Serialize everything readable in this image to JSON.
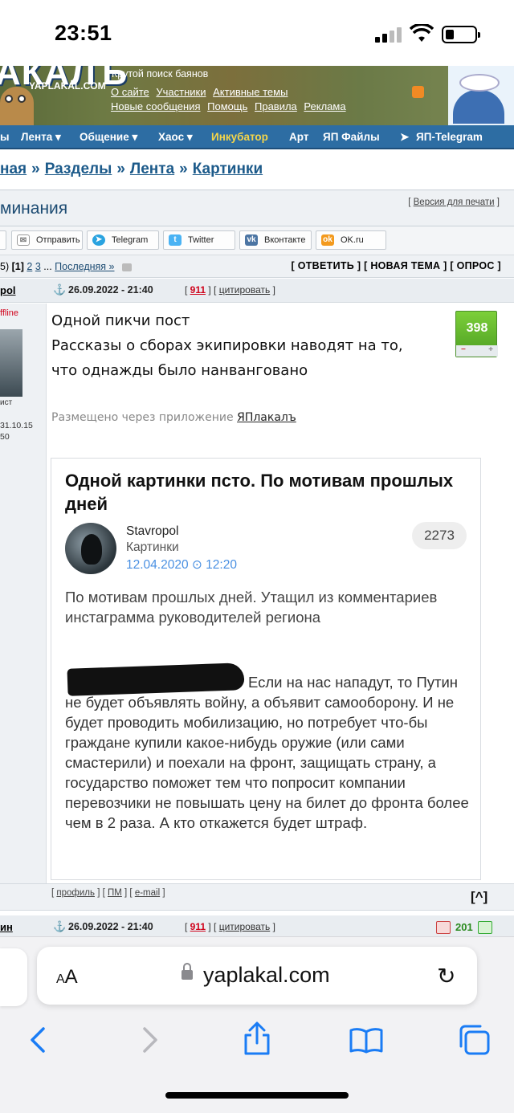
{
  "status_bar": {
    "time": "23:51",
    "battery_level": 0.3
  },
  "header": {
    "logo_text": "АКАЛЪ",
    "logo_sub": "YAPLAKAL.COM",
    "tagline": "Крутой поиск баянов",
    "links_row1": [
      "О сайте",
      "Участники",
      "Активные темы"
    ],
    "links_row2": [
      "Новые сообщения",
      "Помощь",
      "Правила",
      "Реклама"
    ]
  },
  "nav": {
    "items": [
      "ы",
      "Лента ▾",
      "Общение ▾",
      "Хаос ▾",
      "Инкубатор",
      "Арт",
      "ЯП Файлы",
      "ЯП-Telegram"
    ],
    "highlight_color": "#f4d54a"
  },
  "breadcrumbs": {
    "items": [
      "ная",
      "Разделы",
      "Лента",
      "Картинки"
    ],
    "sep": "»"
  },
  "topic": {
    "title": "минания",
    "print_link": "Версия для печати"
  },
  "share": {
    "buttons": [
      {
        "label": "Отправить",
        "icon": "mail-icon"
      },
      {
        "label": "Telegram",
        "icon": "telegram-icon",
        "color": "#2aa3e0"
      },
      {
        "label": "Twitter",
        "icon": "twitter-icon",
        "color": "#4ab3f4"
      },
      {
        "label": "Вконтакте",
        "icon": "vk-icon",
        "color": "#4c75a3"
      },
      {
        "label": "OK.ru",
        "icon": "ok-icon",
        "color": "#f39a1e"
      }
    ]
  },
  "pager": {
    "prefix": "5)",
    "current": "[1]",
    "pages": [
      "2",
      "3"
    ],
    "ellipsis": "...",
    "last": "Последняя »",
    "actions": "[ ОТВЕТИТЬ ] [ НОВАЯ ТЕМА ] [ ОПРОС ]"
  },
  "post1": {
    "author": "pol",
    "date": "26.09.2022 - 21:40",
    "num": "911",
    "cite": "цитировать",
    "status": "ffline",
    "rank": "ист",
    "reg": "31.10.15",
    "posts": "50",
    "lines": [
      "Одной пикчи пост",
      "Рассказы о сборах экипировки наводят на то,",
      "что однажды было нанвангованo"
    ],
    "score": "398",
    "via_text": "Размещено через приложение",
    "via_link": "ЯПлакалъ",
    "footer_links": [
      "профиль",
      "ПМ",
      "e-mail"
    ],
    "top_link": "[^]"
  },
  "embedded": {
    "title": "Одной картинки псто. По мотивам прошлых дней",
    "user": "Stavropol",
    "category": "Картинки",
    "date": "12.04.2020 ⊙ 12:20",
    "count": "2273",
    "intro": "По мотивам прошлых дней. Утащил из комментариев инстаграмма руководителей региона",
    "body": "Если на нас нападут, то Путин не будет объявлять войну, а объявит самооборону.  И не будет проводить мобилизацию, но потребует что-бы граждане купили какое-нибудь оружие (или сами смастерили) и поехали на фронт, защищать страну, а государство поможет тем что попросит компании перевозчики не повышать цену на билет до фронта более чем в 2 раза. А кто откажется будет штраф."
  },
  "post2": {
    "author": "ин",
    "date": "26.09.2022 - 21:40",
    "num": "911",
    "cite": "цитировать",
    "score": "201"
  },
  "safari": {
    "aa": "AA",
    "url": "yaplakal.com"
  }
}
